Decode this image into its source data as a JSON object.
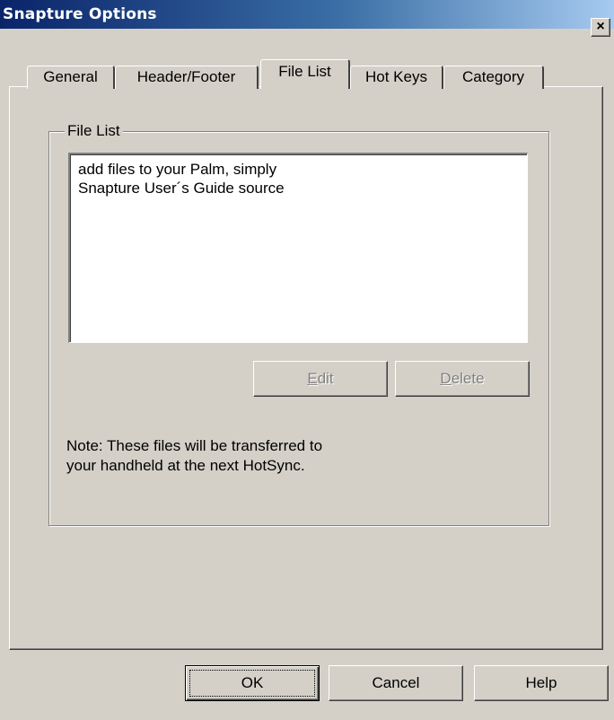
{
  "window": {
    "title": "Snapture Options",
    "close_symbol": "×"
  },
  "tabs": [
    {
      "label": "General",
      "active": false
    },
    {
      "label": "Header/Footer",
      "active": false
    },
    {
      "label": "File List",
      "active": true
    },
    {
      "label": "Hot Keys",
      "active": false
    },
    {
      "label": "Category",
      "active": false
    }
  ],
  "file_list": {
    "group_label": "File List",
    "items": [
      "add files to your Palm, simply",
      "Snapture User´s Guide source"
    ],
    "edit_button": {
      "label_key": "E",
      "label_rest": "dit",
      "enabled": false
    },
    "delete_button": {
      "label_key": "D",
      "label_rest": "elete",
      "enabled": false
    },
    "note_line1": "Note: These files will be transferred to",
    "note_line2": "your handheld at the next HotSync."
  },
  "footer": {
    "ok_label": "OK",
    "cancel_label": "Cancel",
    "help_label": "Help"
  }
}
